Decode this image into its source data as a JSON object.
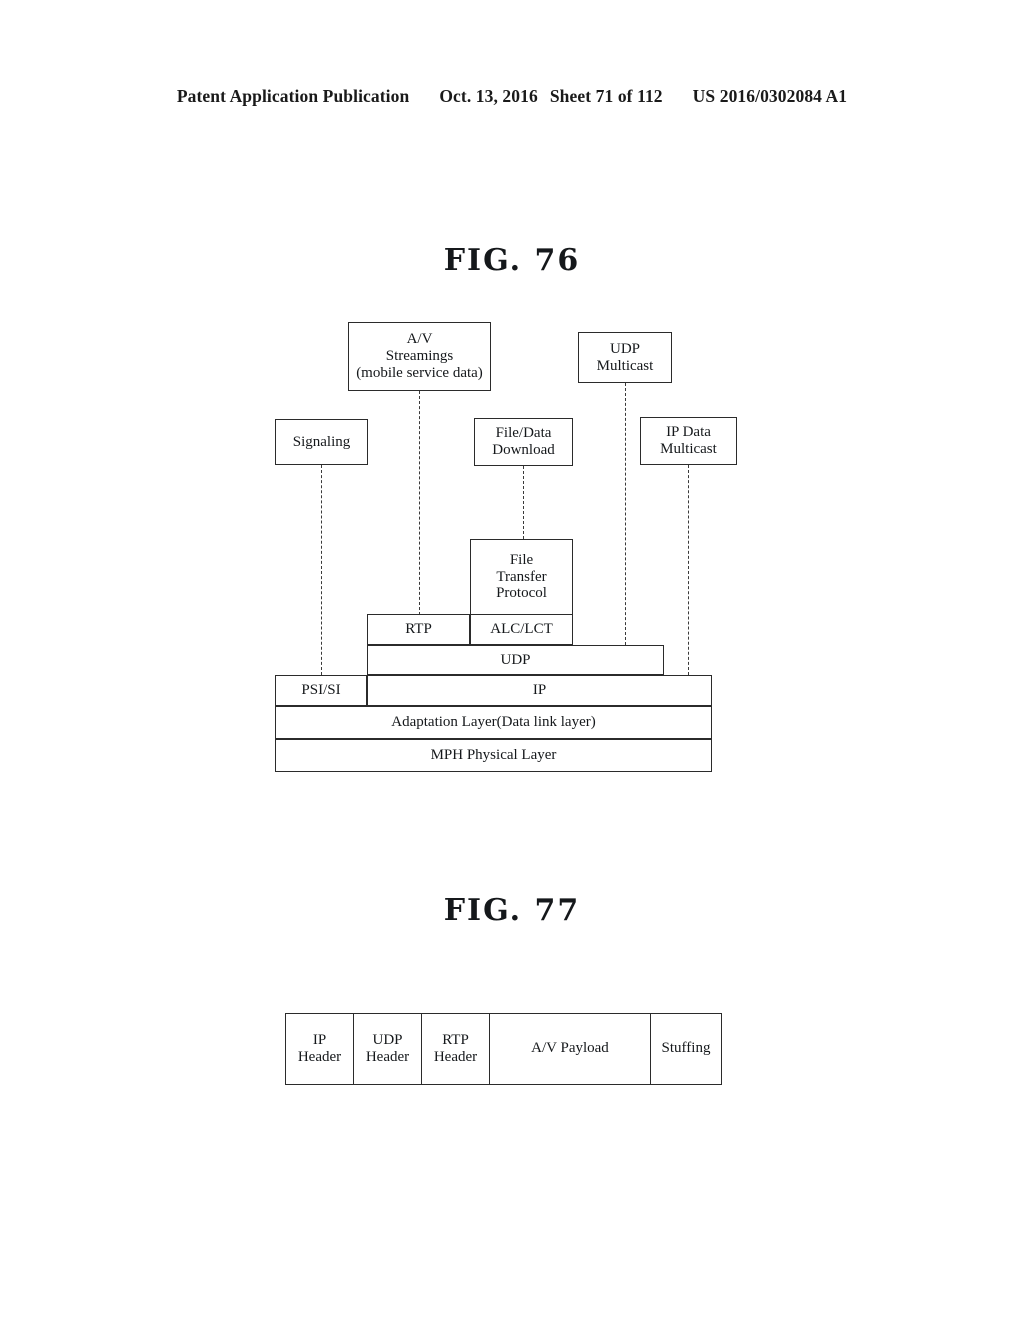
{
  "page_header": {
    "publication": "Patent Application Publication",
    "date": "Oct. 13, 2016",
    "sheet": "Sheet 71 of 112",
    "patent_number": "US 2016/0302084 A1"
  },
  "figures": [
    {
      "title": "FIG. 76",
      "boxes": {
        "av_streamings": {
          "line1": "A/V",
          "line2": "Streamings",
          "line3": "(mobile service data)"
        },
        "udp_multicast": {
          "line1": "UDP",
          "line2": "Multicast"
        },
        "signaling": {
          "line1": "Signaling"
        },
        "file_data_download": {
          "line1": "File/Data",
          "line2": "Download"
        },
        "ip_data_multicast": {
          "line1": "IP Data",
          "line2": "Multicast"
        },
        "file_transfer_protocol": {
          "line1": "File",
          "line2": "Transfer",
          "line3": "Protocol"
        }
      },
      "stack": {
        "rtp": "RTP",
        "alc_lct": "ALC/LCT",
        "udp": "UDP",
        "psi_si": "PSI/SI",
        "ip": "IP",
        "adaptation_layer": "Adaptation Layer(Data link layer)",
        "physical_layer": "MPH Physical Layer"
      }
    },
    {
      "title": "FIG. 77",
      "packet_cells": [
        {
          "line1": "IP",
          "line2": "Header"
        },
        {
          "line1": "UDP",
          "line2": "Header"
        },
        {
          "line1": "RTP",
          "line2": "Header"
        },
        {
          "line1": "A/V Payload",
          "line2": ""
        },
        {
          "line1": "Stuffing",
          "line2": ""
        }
      ]
    }
  ],
  "colors": {
    "ink": "#15181b",
    "stroke": "#2b2b2b",
    "background": "#ffffff"
  }
}
